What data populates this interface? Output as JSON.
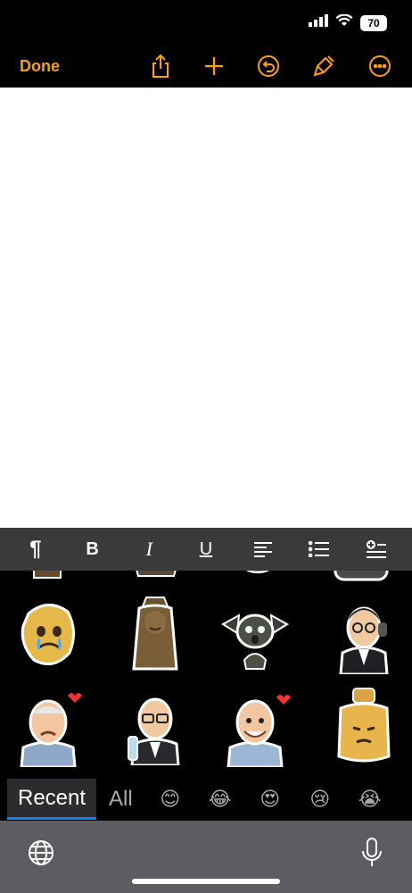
{
  "status": {
    "battery": "70",
    "signal_icon": "signal-icon",
    "wifi_icon": "wifi-icon"
  },
  "nav": {
    "done_label": "Done",
    "accent": "#ff9f0a",
    "icons": [
      "share-icon",
      "add-icon",
      "undo-icon",
      "markup-icon",
      "more-icon"
    ]
  },
  "format_toolbar": {
    "paragraph": "¶",
    "bold": "B",
    "italic": "I",
    "underline": "U"
  },
  "stickers": [
    "gold-nugget-sticker",
    "wooden-statue-sticker",
    "gargoyle-sticker",
    "man-headphones-sticker",
    "old-man-heart-sticker",
    "man-glasses-bottle-sticker",
    "old-man-smiling-sticker",
    "perfume-bottle-sticker"
  ],
  "categories": {
    "recent": "Recent",
    "all": "All",
    "emojis": [
      "😊",
      "😂",
      "😍",
      "😢",
      "😭"
    ]
  }
}
